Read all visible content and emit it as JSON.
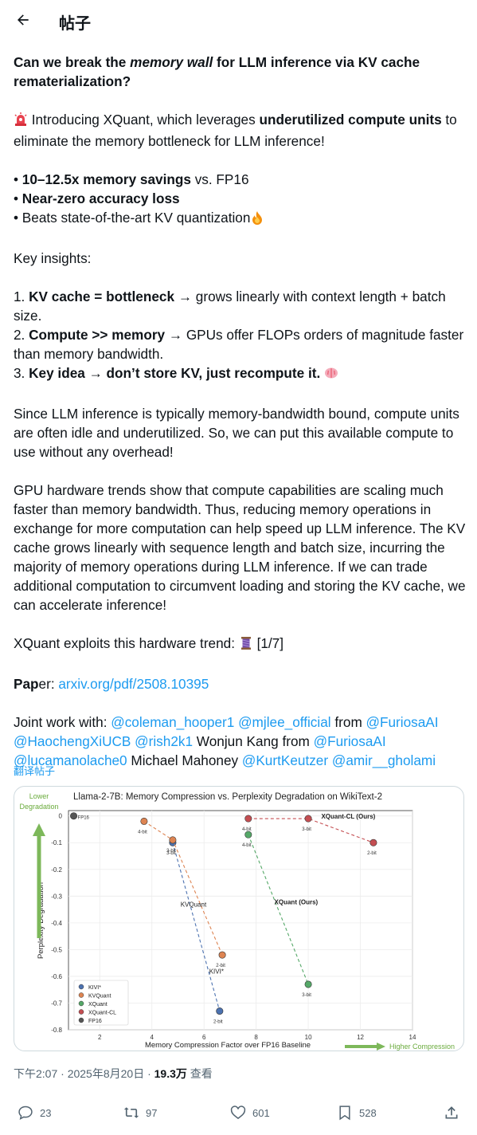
{
  "header": {
    "title": "帖子"
  },
  "post": {
    "q1": "Can we break the ",
    "q2": "memory wall",
    "q3": " for LLM inference via KV cache rematerialization?",
    "intro1": " Introducing XQuant, which leverages ",
    "intro2": "underutilized compute units",
    "intro3": " to eliminate the memory bottleneck for LLM inference!",
    "b1a": "• ",
    "b1b": "10–12.5x memory savings",
    "b1c": " vs. FP16",
    "b2a": "• ",
    "b2b": "Near-zero accuracy loss",
    "b3": "• Beats state-of-the-art KV quantization",
    "key": "Key insights:",
    "k1a": "1. ",
    "k1b": "KV cache = bottleneck",
    "k1c": " → grows linearly with context length + batch size.",
    "k2a": "2. ",
    "k2b": "Compute >> memory",
    "k2c": " → GPUs offer FLOPs orders of magnitude faster than memory bandwidth.",
    "k3a": "3. ",
    "k3b": "Key idea → don’t store KV, just recompute it.",
    "para1": "Since LLM inference is typically memory-bandwidth bound, compute units are often idle and underutilized. So, we can put this available compute to use without any overhead!",
    "para2": "GPU hardware trends show that compute capabilities are scaling much faster than memory bandwidth. Thus, reducing memory operations in exchange for more computation can help speed up LLM inference. The KV cache grows linearly with sequence length and batch size, incurring the majority of memory operations during LLM inference. If we can trade additional computation to circumvent loading and storing the KV cache, we can accelerate inference!",
    "exploit1": "XQuant exploits this hardware trend: ",
    "exploit2": " [1/7]",
    "paper_label_a": "Pap",
    "paper_label_b": "er: ",
    "paper_link": "arxiv.org/pdf/2508.10395",
    "joint": "Joint work with: ",
    "h_coleman": "@coleman_hooper1",
    "h_mjlee": "@mjlee_official",
    "from1": " from ",
    "h_furiosa1": "@FuriosaAI",
    "h_haocheng": "@HaochengXiUCB",
    "h_rish": "@rish2k1",
    "wonjun": " Wonjun Kang from ",
    "h_furiosa2": "@FuriosaAI",
    "h_luca": "@lucamanolache0",
    "mahoney": " Michael Mahoney ",
    "h_kurt": "@KurtKeutzer",
    "h_amir": "@amir__gholami"
  },
  "translate": "翻译帖子",
  "meta": {
    "time": "下午2:07 · 2025年8月20日 · ",
    "views": "19.3万",
    "views_label": " 查看"
  },
  "actions": {
    "replies": "23",
    "reposts": "97",
    "likes": "601",
    "bookmarks": "528"
  },
  "chart_data": {
    "type": "scatter",
    "title": "Llama-2-7B: Memory Compression vs. Perplexity Degradation on WikiText-2",
    "xlabel": "Memory Compression Factor over FP16 Baseline",
    "ylabel": "Perplexity Degradation",
    "xlim": [
      0.8,
      14
    ],
    "ylim": [
      -0.8,
      0.02
    ],
    "xticks": [
      "2",
      "4",
      "6",
      "8",
      "10",
      "12",
      "14"
    ],
    "yticks": [
      "0",
      "-0.1",
      "-0.2",
      "-0.3",
      "-0.4",
      "-0.5",
      "-0.6",
      "-0.7",
      "-0.8"
    ],
    "annot_top": "Lower Degradation",
    "annot_top_line1": "Lower",
    "annot_top_line2": "Degradation",
    "annot_right": "Higher Compression",
    "series": [
      {
        "name": "KIVI*",
        "color": "#4c72b0",
        "label": "KIVI*",
        "label_pos": [
          6.2,
          -0.59
        ],
        "points": [
          {
            "x": 4.8,
            "y": -0.1,
            "t": "3-bit"
          },
          {
            "x": 6.6,
            "y": -0.73,
            "t": "2-bit"
          }
        ]
      },
      {
        "name": "KVQuant",
        "color": "#dd8452",
        "label": "KVQuant",
        "label_pos": [
          5.1,
          -0.34
        ],
        "points": [
          {
            "x": 3.7,
            "y": -0.02,
            "t": "4-bit"
          },
          {
            "x": 4.8,
            "y": -0.09,
            "t": "3-bit"
          },
          {
            "x": 6.7,
            "y": -0.52,
            "t": "2-bit"
          }
        ]
      },
      {
        "name": "XQuant",
        "color": "#55a868",
        "label": "XQuant (Ours)",
        "label_pos": [
          8.7,
          -0.33
        ],
        "points": [
          {
            "x": 7.7,
            "y": -0.07,
            "t": "4-bit"
          },
          {
            "x": 10.0,
            "y": -0.63,
            "t": "3-bit"
          }
        ]
      },
      {
        "name": "XQuant-CL",
        "color": "#c44e52",
        "label": "XQuant-CL (Ours)",
        "label_pos": [
          10.5,
          -0.01
        ],
        "points": [
          {
            "x": 7.7,
            "y": -0.01,
            "t": "4-bit"
          },
          {
            "x": 10.0,
            "y": -0.01,
            "t": "3-bit"
          },
          {
            "x": 12.5,
            "y": -0.1,
            "t": "2-bit"
          }
        ]
      },
      {
        "name": "FP16",
        "color": "#555555",
        "label": "FP16",
        "points": [
          {
            "x": 1.0,
            "y": 0.0,
            "t": ""
          }
        ]
      }
    ]
  }
}
